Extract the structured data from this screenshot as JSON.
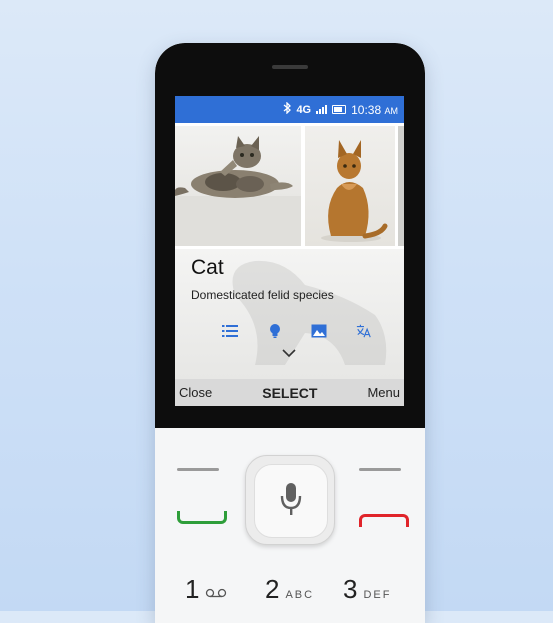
{
  "status_bar": {
    "bluetooth_icon": "bluetooth-icon",
    "network": "4G",
    "time": "10:38",
    "am_pm": "AM"
  },
  "card": {
    "title": "Cat",
    "subtitle": "Domesticated felid species",
    "actions": [
      "list-icon",
      "lightbulb-icon",
      "image-icon",
      "translate-icon"
    ]
  },
  "softkeys": {
    "left": "Close",
    "center": "SELECT",
    "right": "Menu"
  },
  "keypad": {
    "keys": [
      {
        "digit": "1",
        "letters": ""
      },
      {
        "digit": "2",
        "letters": "ABC"
      },
      {
        "digit": "3",
        "letters": "DEF"
      }
    ]
  },
  "colors": {
    "status_bar": "#2f6fd6",
    "accent_icons": "#2f6fd6",
    "call_green": "#2e9e3a",
    "end_red": "#e0242a"
  }
}
